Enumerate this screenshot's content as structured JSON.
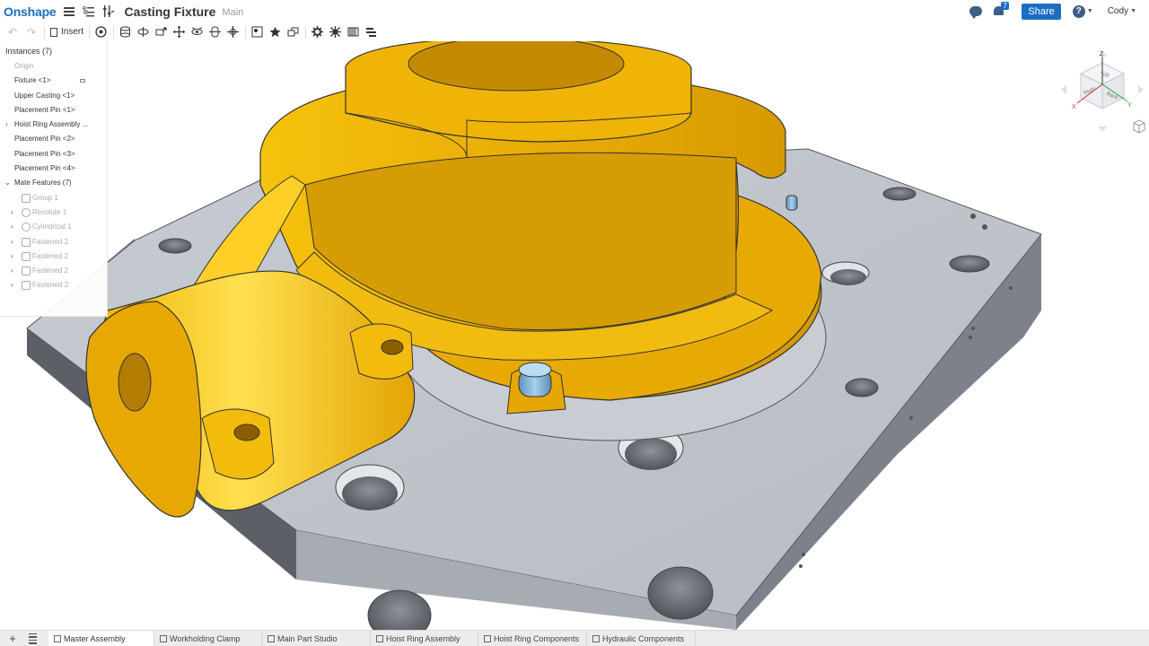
{
  "header": {
    "logo": "Onshape",
    "title": "Casting Fixture",
    "workspace": "Main",
    "notifications_count": "7",
    "share_label": "Share",
    "help_label": "?",
    "user": "Cody"
  },
  "toolbar": {
    "insert_label": "Insert"
  },
  "instances": {
    "title": "Instances (7)",
    "items": [
      {
        "label": "Origin"
      },
      {
        "label": "Fixture <1>"
      },
      {
        "label": "Upper Casting <1>"
      },
      {
        "label": "Placement Pin <1>"
      },
      {
        "label": "Hoist Ring Assembly ..."
      },
      {
        "label": "Placement Pin <2>"
      },
      {
        "label": "Placement Pin <3>"
      },
      {
        "label": "Placement Pin <4>"
      },
      {
        "label": "Mate Features (7)"
      },
      {
        "label": "Group 1"
      },
      {
        "label": "Revolute 1"
      },
      {
        "label": "Cylindrical 1"
      },
      {
        "label": "Fastened 2"
      },
      {
        "label": "Fastened 2"
      },
      {
        "label": "Fastened 2"
      },
      {
        "label": "Fastened 2"
      }
    ]
  },
  "viewcube": {
    "top": "Top",
    "right": "Right",
    "back": "Back",
    "axis_x": "X",
    "axis_y": "Y",
    "axis_z": "Z"
  },
  "tabs": [
    {
      "label": "Master Assembly"
    },
    {
      "label": "Workholding Clamp"
    },
    {
      "label": "Main Part Studio"
    },
    {
      "label": "Hoist Ring Assembly"
    },
    {
      "label": "Hoist Ring Components"
    },
    {
      "label": "Hydraulic Components"
    }
  ],
  "colors": {
    "brand": "#1b6ec2",
    "casting": "#e9ad05",
    "fixture": "#bfc4cb",
    "pin": "#8cc0e2"
  }
}
